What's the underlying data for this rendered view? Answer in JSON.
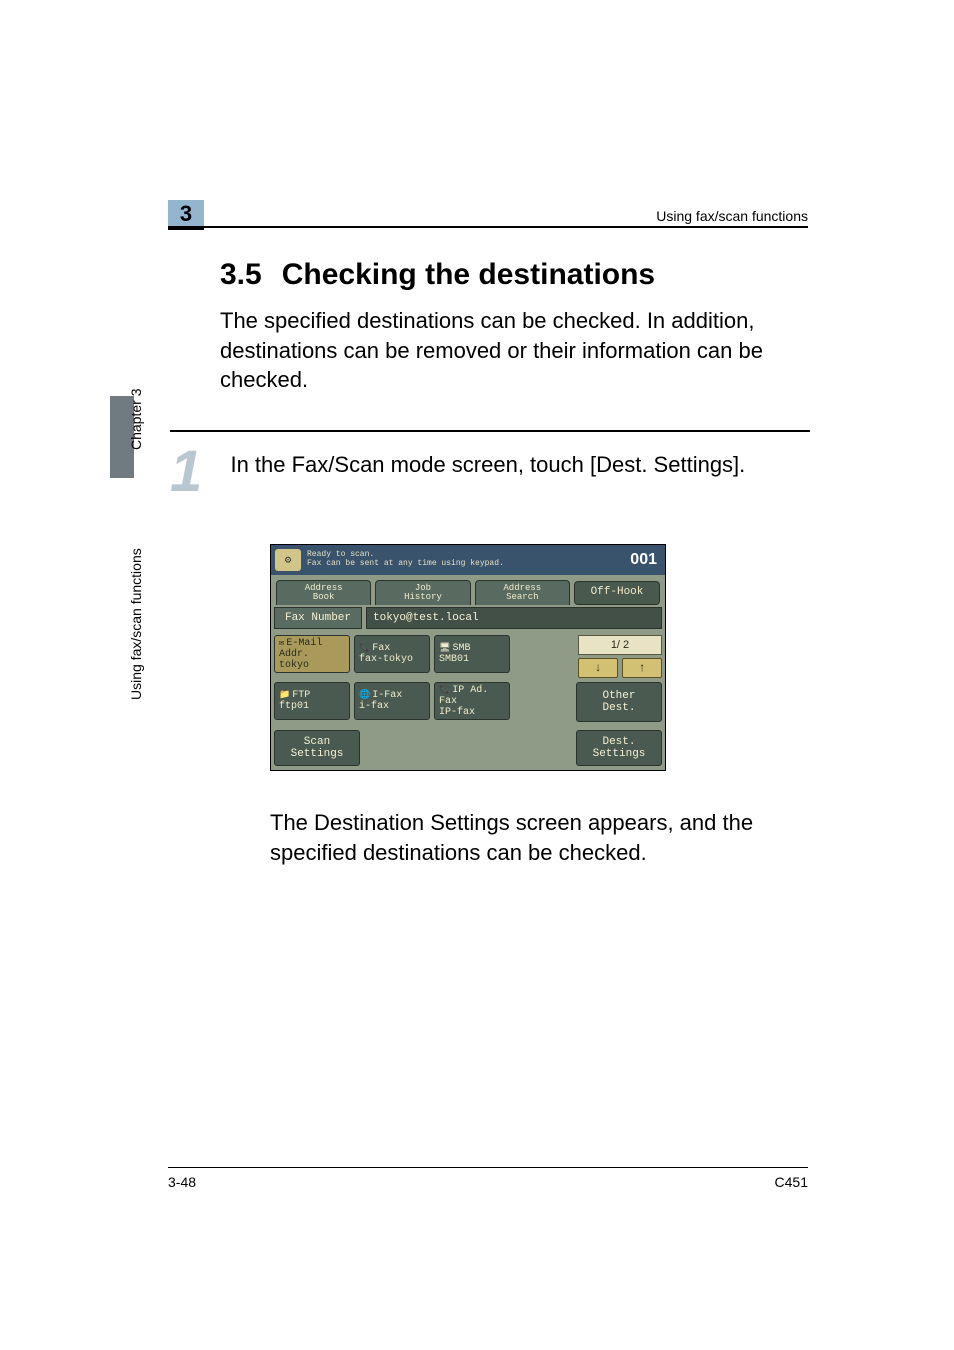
{
  "header": {
    "chapter_num": "3",
    "right_label": "Using fax/scan functions"
  },
  "section": {
    "number": "3.5",
    "title": "Checking the destinations"
  },
  "intro": "The specified destinations can be checked. In addition, destinations can be removed or their information can be checked.",
  "side": {
    "chapter_label": "Chapter 3",
    "side_label": "Using fax/scan functions"
  },
  "step": {
    "num": "1",
    "text": "In the Fax/Scan mode screen, touch [Dest. Settings]."
  },
  "screen": {
    "top_line1": "Ready to scan.",
    "top_line2": "Fax can be sent at any time using keypad.",
    "icon_glyph": "⚙",
    "counter": "001",
    "tabs": {
      "address_book": "Address\nBook",
      "job_history": "Job\nHistory",
      "address_search": "Address\nSearch",
      "off_hook": "Off-Hook"
    },
    "fax_number_label": "Fax Number",
    "fax_number_value": "tokyo@test.local",
    "row1": {
      "btn1": {
        "type": "E-Mail\nAddr.",
        "name": "tokyo"
      },
      "btn2": {
        "type": "Fax",
        "name": "fax-tokyo"
      },
      "btn3": {
        "type": "SMB",
        "name": "SMB01"
      }
    },
    "row2": {
      "btn1": {
        "type": "FTP",
        "name": "ftp01"
      },
      "btn2": {
        "type": "I-Fax",
        "name": "i-fax"
      },
      "btn3": {
        "type": "IP Ad.\nFax",
        "name": "IP-fax"
      }
    },
    "page_indicator": "1/  2",
    "arrow_down": "↓",
    "arrow_up": "↑",
    "other_dest": "Other\nDest.",
    "scan_settings": "Scan\nSettings",
    "dest_settings": "Dest.\nSettings"
  },
  "result": "The Destination Settings screen appears, and the specified destinations can be checked.",
  "footer": {
    "left": "3-48",
    "right": "C451"
  }
}
